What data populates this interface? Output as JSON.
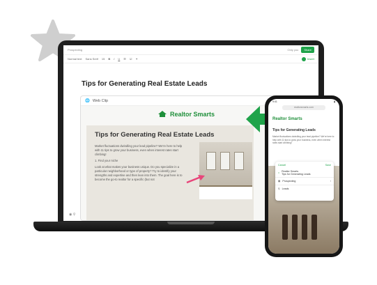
{
  "editor": {
    "notebook": "Prospecting",
    "sync": "Only you",
    "share": "Share",
    "font_style": "Normal text",
    "font": "Sans Serif",
    "font_size": "15",
    "insert": "Insert"
  },
  "note": {
    "title": "Tips for Generating Real Estate Leads",
    "clip_label": "Web Clip"
  },
  "article": {
    "brand": "Realtor Smarts",
    "title": "Tips for Generating Real Estate Leads",
    "p1": "Market fluctuations dwindling your lead pipeline? We're here to help with 11 tips to grow your business, even when interest rates start climbing!",
    "p2": "1. Find your niche",
    "p3": "Look at what makes your business unique. Do you specialize in a particular neighborhood or type of property? Try to identify your strengths and expertise and then lean into them. The goal here is to become the go-to realtor for a specific (but not"
  },
  "phone": {
    "time": "9:41",
    "url": "realtorsmarts.com",
    "brand": "Realtor Smarts",
    "tips": "Tips for Generating Leads",
    "text": "Market fluctuations dwindling your lead pipeline? We're here to help with 11 tips to grow your business, even when interest rates start climbing!",
    "sheet": {
      "cancel": "Cancel",
      "save": "Save",
      "site": "Realtor Smarts",
      "page": "Tips for Generating Leads",
      "notebook": "Prospecting",
      "tag": "Leads"
    }
  },
  "colors": {
    "accent": "#1fa34a",
    "brand": "#1f8f3a",
    "arrow": "#e8457a"
  }
}
